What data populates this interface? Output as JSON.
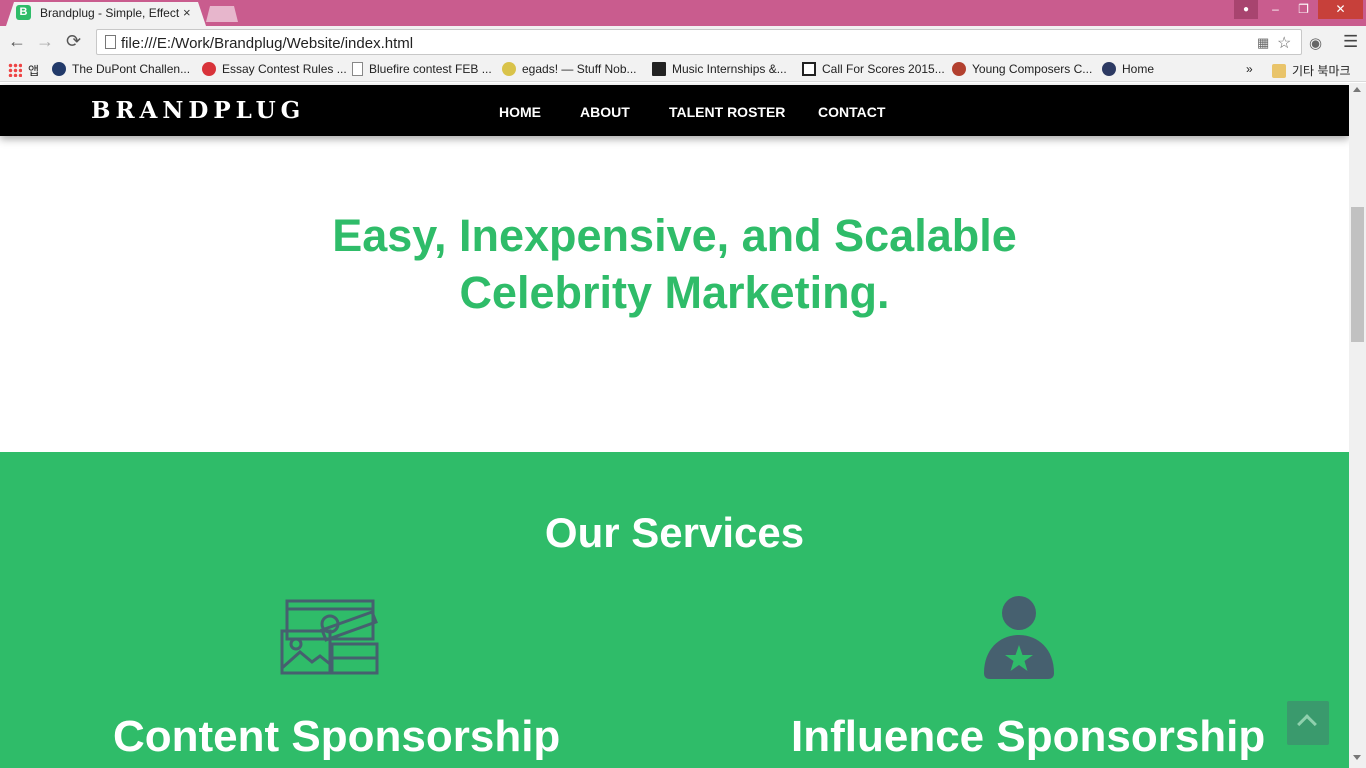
{
  "browser": {
    "tab_title": "Brandplug - Simple, Effect",
    "tab_favicon_letter": "B",
    "tab_close": "×",
    "url": "file:///E:/Work/Brandplug/Website/index.html",
    "window_controls": {
      "minimize": "–",
      "restore": "❐",
      "close": "✕"
    },
    "nav": {
      "back": "←",
      "forward": "→",
      "reload": "⟳"
    },
    "bookmarks": [
      {
        "label": "앱",
        "icon": "apps-grid-icon"
      },
      {
        "label": "The DuPont Challen...",
        "icon": "dupont-icon"
      },
      {
        "label": "Essay Contest Rules ...",
        "icon": "red-flower-icon"
      },
      {
        "label": "Bluefire contest FEB ...",
        "icon": "page-icon"
      },
      {
        "label": "egads! — Stuff Nob...",
        "icon": "egads-icon"
      },
      {
        "label": "Music Internships &...",
        "icon": "music-icon"
      },
      {
        "label": "Call For Scores 2015...",
        "icon": "score-icon"
      },
      {
        "label": "Young Composers C...",
        "icon": "composers-icon"
      },
      {
        "label": "Home",
        "icon": "kiwanis-icon"
      }
    ],
    "bookmarks_overflow": "»",
    "other_bookmarks": "기타 북마크"
  },
  "site": {
    "brand": "BRANDPLUG",
    "nav": [
      "HOME",
      "ABOUT",
      "TALENT ROSTER",
      "CONTACT"
    ],
    "hero_line1": "Easy, Inexpensive, and Scalable",
    "hero_line2": "Celebrity Marketing.",
    "services_title": "Our Services",
    "services": [
      {
        "title": "Content Sponsorship",
        "icon": "media-content-icon"
      },
      {
        "title": "Influence Sponsorship",
        "icon": "star-person-icon"
      }
    ]
  },
  "colors": {
    "accent_green": "#2fbc69",
    "icon_slate": "#46606f",
    "chrome_pink": "#c95c8e"
  }
}
